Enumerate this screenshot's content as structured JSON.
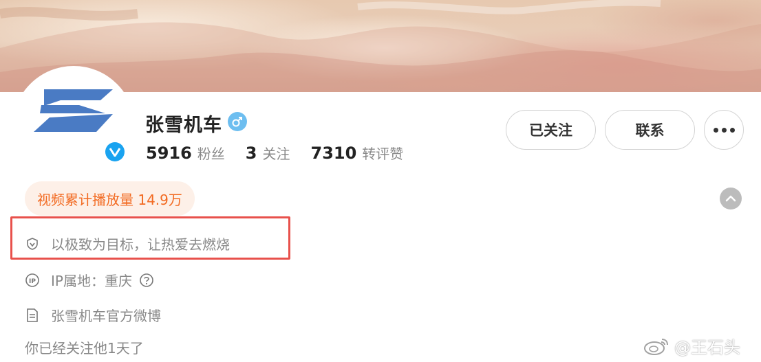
{
  "profile": {
    "name": "张雪机车",
    "gender": "male"
  },
  "stats": [
    {
      "num": "5916",
      "label": "粉丝"
    },
    {
      "num": "3",
      "label": "关注"
    },
    {
      "num": "7310",
      "label": "转评赞"
    }
  ],
  "buttons": {
    "followed": "已关注",
    "contact": "联系"
  },
  "play_badge": "视频累计播放量 14.9万",
  "bio": "以极致为目标，让热爱去燃烧",
  "ip_location": "IP属地：重庆",
  "official_desc": "张雪机车官方微博",
  "follow_duration": "你已经关注他1天了",
  "watermark": "@王石头",
  "colors": {
    "accent_orange": "#f26a21",
    "badge_bg": "#fdf0e8",
    "verified_blue": "#1aa3f0",
    "gender_blue": "#6dbef0",
    "highlight_red": "#e8514c",
    "logo_blue": "#4a7bc4"
  },
  "icons": {
    "verified": "verified-v-icon",
    "gender": "male-icon",
    "bio": "shield-icon",
    "ip": "ip-icon",
    "help": "question-icon",
    "desc": "document-icon",
    "collapse": "chevron-up-icon",
    "more": "more-dots-icon"
  }
}
